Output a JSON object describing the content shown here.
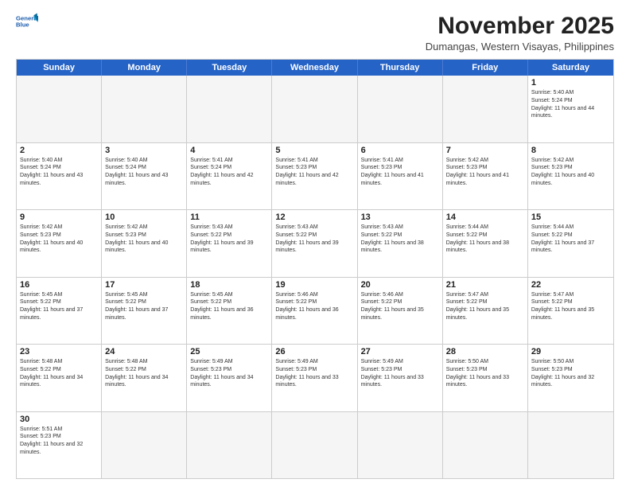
{
  "logo": {
    "line1": "General",
    "line2": "Blue"
  },
  "title": "November 2025",
  "location": "Dumangas, Western Visayas, Philippines",
  "days": [
    "Sunday",
    "Monday",
    "Tuesday",
    "Wednesday",
    "Thursday",
    "Friday",
    "Saturday"
  ],
  "rows": [
    [
      {
        "day": "",
        "empty": true
      },
      {
        "day": "",
        "empty": true
      },
      {
        "day": "",
        "empty": true
      },
      {
        "day": "",
        "empty": true
      },
      {
        "day": "",
        "empty": true
      },
      {
        "day": "",
        "empty": true
      },
      {
        "day": "1",
        "sunrise": "5:40 AM",
        "sunset": "5:24 PM",
        "daylight": "11 hours and 44 minutes."
      }
    ],
    [
      {
        "day": "2",
        "sunrise": "5:40 AM",
        "sunset": "5:24 PM",
        "daylight": "11 hours and 43 minutes."
      },
      {
        "day": "3",
        "sunrise": "5:40 AM",
        "sunset": "5:24 PM",
        "daylight": "11 hours and 43 minutes."
      },
      {
        "day": "4",
        "sunrise": "5:41 AM",
        "sunset": "5:24 PM",
        "daylight": "11 hours and 42 minutes."
      },
      {
        "day": "5",
        "sunrise": "5:41 AM",
        "sunset": "5:23 PM",
        "daylight": "11 hours and 42 minutes."
      },
      {
        "day": "6",
        "sunrise": "5:41 AM",
        "sunset": "5:23 PM",
        "daylight": "11 hours and 41 minutes."
      },
      {
        "day": "7",
        "sunrise": "5:42 AM",
        "sunset": "5:23 PM",
        "daylight": "11 hours and 41 minutes."
      },
      {
        "day": "8",
        "sunrise": "5:42 AM",
        "sunset": "5:23 PM",
        "daylight": "11 hours and 40 minutes."
      }
    ],
    [
      {
        "day": "9",
        "sunrise": "5:42 AM",
        "sunset": "5:23 PM",
        "daylight": "11 hours and 40 minutes."
      },
      {
        "day": "10",
        "sunrise": "5:42 AM",
        "sunset": "5:23 PM",
        "daylight": "11 hours and 40 minutes."
      },
      {
        "day": "11",
        "sunrise": "5:43 AM",
        "sunset": "5:22 PM",
        "daylight": "11 hours and 39 minutes."
      },
      {
        "day": "12",
        "sunrise": "5:43 AM",
        "sunset": "5:22 PM",
        "daylight": "11 hours and 39 minutes."
      },
      {
        "day": "13",
        "sunrise": "5:43 AM",
        "sunset": "5:22 PM",
        "daylight": "11 hours and 38 minutes."
      },
      {
        "day": "14",
        "sunrise": "5:44 AM",
        "sunset": "5:22 PM",
        "daylight": "11 hours and 38 minutes."
      },
      {
        "day": "15",
        "sunrise": "5:44 AM",
        "sunset": "5:22 PM",
        "daylight": "11 hours and 37 minutes."
      }
    ],
    [
      {
        "day": "16",
        "sunrise": "5:45 AM",
        "sunset": "5:22 PM",
        "daylight": "11 hours and 37 minutes."
      },
      {
        "day": "17",
        "sunrise": "5:45 AM",
        "sunset": "5:22 PM",
        "daylight": "11 hours and 37 minutes."
      },
      {
        "day": "18",
        "sunrise": "5:45 AM",
        "sunset": "5:22 PM",
        "daylight": "11 hours and 36 minutes."
      },
      {
        "day": "19",
        "sunrise": "5:46 AM",
        "sunset": "5:22 PM",
        "daylight": "11 hours and 36 minutes."
      },
      {
        "day": "20",
        "sunrise": "5:46 AM",
        "sunset": "5:22 PM",
        "daylight": "11 hours and 35 minutes."
      },
      {
        "day": "21",
        "sunrise": "5:47 AM",
        "sunset": "5:22 PM",
        "daylight": "11 hours and 35 minutes."
      },
      {
        "day": "22",
        "sunrise": "5:47 AM",
        "sunset": "5:22 PM",
        "daylight": "11 hours and 35 minutes."
      }
    ],
    [
      {
        "day": "23",
        "sunrise": "5:48 AM",
        "sunset": "5:22 PM",
        "daylight": "11 hours and 34 minutes."
      },
      {
        "day": "24",
        "sunrise": "5:48 AM",
        "sunset": "5:22 PM",
        "daylight": "11 hours and 34 minutes."
      },
      {
        "day": "25",
        "sunrise": "5:49 AM",
        "sunset": "5:23 PM",
        "daylight": "11 hours and 34 minutes."
      },
      {
        "day": "26",
        "sunrise": "5:49 AM",
        "sunset": "5:23 PM",
        "daylight": "11 hours and 33 minutes."
      },
      {
        "day": "27",
        "sunrise": "5:49 AM",
        "sunset": "5:23 PM",
        "daylight": "11 hours and 33 minutes."
      },
      {
        "day": "28",
        "sunrise": "5:50 AM",
        "sunset": "5:23 PM",
        "daylight": "11 hours and 33 minutes."
      },
      {
        "day": "29",
        "sunrise": "5:50 AM",
        "sunset": "5:23 PM",
        "daylight": "11 hours and 32 minutes."
      }
    ],
    [
      {
        "day": "30",
        "sunrise": "5:51 AM",
        "sunset": "5:23 PM",
        "daylight": "11 hours and 32 minutes."
      },
      {
        "day": "",
        "empty": true
      },
      {
        "day": "",
        "empty": true
      },
      {
        "day": "",
        "empty": true
      },
      {
        "day": "",
        "empty": true
      },
      {
        "day": "",
        "empty": true
      },
      {
        "day": "",
        "empty": true
      }
    ]
  ],
  "labels": {
    "sunrise": "Sunrise:",
    "sunset": "Sunset:",
    "daylight": "Daylight:"
  }
}
